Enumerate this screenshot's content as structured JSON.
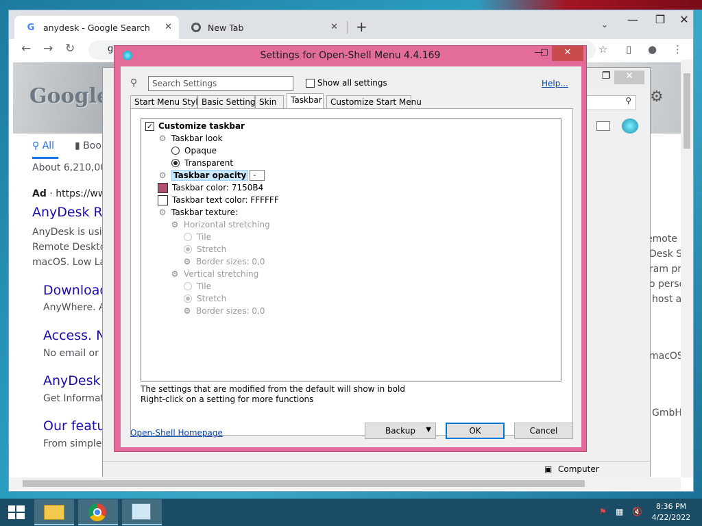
{
  "chrome": {
    "tabs": [
      {
        "title": "anydesk - Google Search",
        "icon": "google-icon"
      },
      {
        "title": "New Tab",
        "icon": "chrome-icon"
      }
    ],
    "close_glyph": "✕",
    "new_tab_glyph": "+",
    "chevron_glyph": "⌄",
    "window_controls": {
      "minimize": "—",
      "restore": "❐",
      "close": "✕"
    },
    "nav": {
      "back": "←",
      "forward": "→",
      "reload": "↻"
    },
    "address_prefix": "g",
    "toolbar_icons": {
      "star": "☆",
      "sidepanel": "▯",
      "profile": "●",
      "menu": "⋮"
    }
  },
  "google": {
    "logo": "Google",
    "nav_all": "All",
    "nav_books": "Boo",
    "results_count": "About 6,210,000",
    "ad_label": "Ad",
    "ad_url": "· https://www",
    "results": [
      {
        "title": "AnyDesk Re",
        "snippet1": "AnyDesk is using",
        "snippet2": "Remote Desktop",
        "snippet3": "macOS. Low Lat"
      },
      {
        "title": "Download",
        "snippet": "AnyWhere. An"
      },
      {
        "title": "Access. N",
        "snippet": "No email or in"
      },
      {
        "title": "AnyDesk",
        "snippet": "Get Informatio"
      },
      {
        "title": "Our featu",
        "snippet": "From simple to"
      }
    ],
    "right_fragments": [
      "emote c",
      "Desk S",
      "ram pro",
      "o perso",
      "host a",
      "macOS",
      "GmbH"
    ]
  },
  "bgwindow": {
    "status_label": "Computer",
    "search_glyph": "⚲"
  },
  "dialog": {
    "title": "Settings for Open-Shell Menu 4.4.169",
    "search_placeholder": "Search Settings",
    "show_all_label": "Show all settings",
    "help_label": "Help...",
    "tabs": [
      "Start Menu Style",
      "Basic Settings",
      "Skin",
      "Taskbar",
      "Customize Start Menu"
    ],
    "active_tab": "Taskbar",
    "tree": {
      "customize_taskbar": "Customize taskbar",
      "taskbar_look": "Taskbar look",
      "opaque": "Opaque",
      "transparent": "Transparent",
      "taskbar_opacity": "Taskbar opacity",
      "opacity_value": "-",
      "taskbar_color": "Taskbar color: 7150B4",
      "taskbar_color_hex": "#b4506f",
      "taskbar_text_color": "Taskbar text color: FFFFFF",
      "taskbar_text_color_hex": "#ffffff",
      "taskbar_texture": "Taskbar texture:",
      "horizontal_stretching": "Horizontal stretching",
      "h_tile": "Tile",
      "h_stretch": "Stretch",
      "h_border": "Border sizes: 0,0",
      "vertical_stretching": "Vertical stretching",
      "v_tile": "Tile",
      "v_stretch": "Stretch",
      "v_border": "Border sizes: 0,0"
    },
    "note1": "The settings that are modified from the default will show in bold",
    "note2": "Right-click on a setting for more functions",
    "homepage_link": "Open-Shell Homepage",
    "backup_label": "Backup",
    "ok_label": "OK",
    "cancel_label": "Cancel"
  },
  "taskbar": {
    "time": "8:36 PM",
    "date": "4/22/2022",
    "apps": [
      "file-explorer",
      "chrome",
      "control-panel"
    ]
  },
  "colors": {
    "dialog_frame": "#e36c9a",
    "taskbar": "#1a4c66"
  }
}
